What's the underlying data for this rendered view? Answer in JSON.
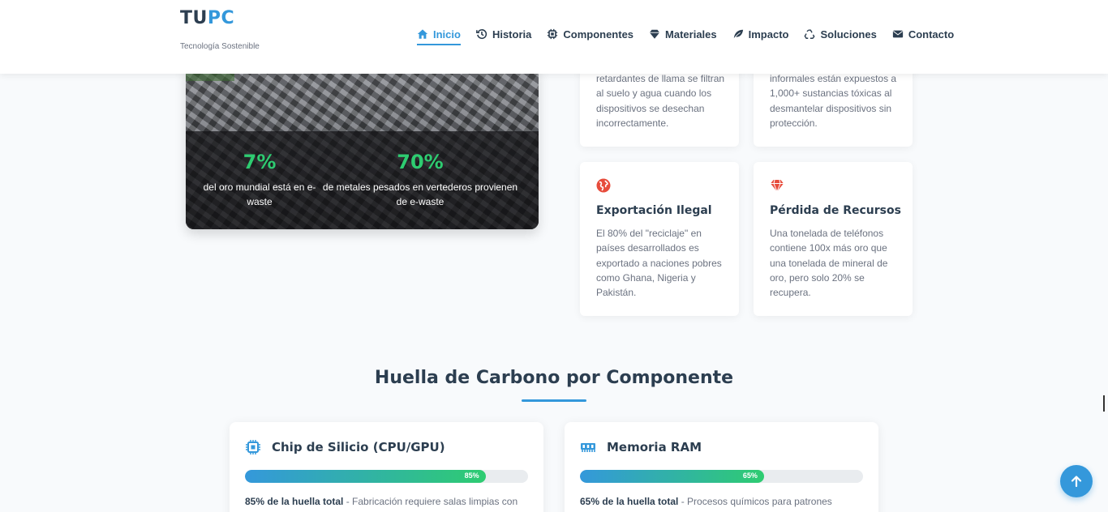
{
  "brand": {
    "name_part1": "TU",
    "name_part2": "PC",
    "tagline": "Tecnología Sostenible"
  },
  "nav": [
    {
      "label": "Inicio",
      "icon": "home-icon",
      "active": true
    },
    {
      "label": "Historia",
      "icon": "history-icon"
    },
    {
      "label": "Componentes",
      "icon": "chip-icon"
    },
    {
      "label": "Materiales",
      "icon": "gem-icon"
    },
    {
      "label": "Impacto",
      "icon": "leaf-icon"
    },
    {
      "label": "Soluciones",
      "icon": "recycle-icon"
    },
    {
      "label": "Contacto",
      "icon": "envelope-icon"
    }
  ],
  "image_stats": [
    {
      "value": "7%",
      "label": "del oro mundial está en e-waste"
    },
    {
      "value": "70%",
      "label": "de metales pesados en vertederos provienen de e-waste"
    }
  ],
  "problem_cards": {
    "top_left_text": "retardantes de llama se filtran al suelo y agua cuando los dispositivos se desechan incorrectamente.",
    "top_right_text": "informales están expuestos a 1,000+ sustancias tóxicas al desmantelar dispositivos sin protección.",
    "export": {
      "title": "Exportación Ilegal",
      "text": "El 80% del \"reciclaje\" en países desarrollados es exportado a naciones pobres como Ghana, Nigeria y Pakistán.",
      "icon": "globe-icon"
    },
    "loss": {
      "title": "Pérdida de Recursos",
      "text": "Una tonelada de teléfonos contiene 100x más oro que una tonelada de mineral de oro, pero solo 20% se recupera.",
      "icon": "gem-icon"
    }
  },
  "carbon_section": {
    "title": "Huella de Carbono por Componente",
    "components": [
      {
        "name": "Chip de Silicio (CPU/GPU)",
        "icon": "microchip-icon",
        "percent": 85,
        "percent_label": "85%",
        "footprint_label": "85% de la huella total",
        "description": " - Fabricación requiere salas limpias con"
      },
      {
        "name": "Memoria RAM",
        "icon": "memory-icon",
        "percent": 65,
        "percent_label": "65%",
        "footprint_label": "65% de la huella total",
        "description": " - Procesos químicos para patrones"
      }
    ]
  },
  "colors": {
    "accent": "#3498db",
    "green": "#2ecc71",
    "red": "#e74c3c",
    "text": "#2c3e50"
  }
}
